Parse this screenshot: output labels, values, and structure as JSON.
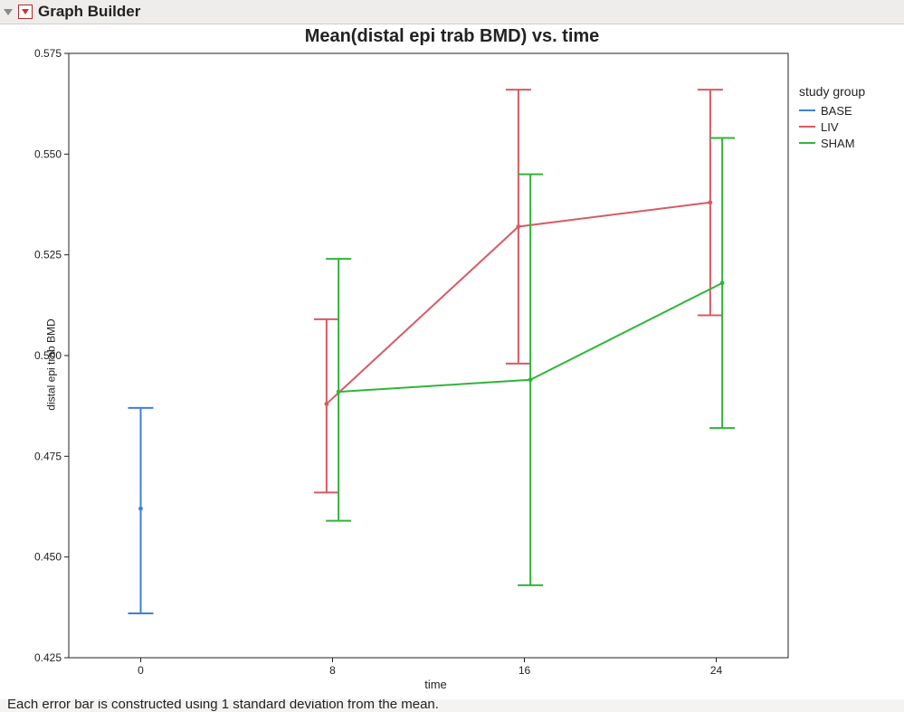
{
  "panel": {
    "title": "Graph Builder"
  },
  "chart_data": {
    "type": "line",
    "title": "Mean(distal epi trab BMD) vs. time",
    "xlabel": "time",
    "ylabel": "distal epi trab BMD",
    "xlim": [
      -3,
      27
    ],
    "ylim": [
      0.425,
      0.575
    ],
    "x_ticks": [
      0,
      8,
      16,
      24
    ],
    "y_ticks": [
      0.425,
      0.45,
      0.475,
      0.5,
      0.525,
      0.55,
      0.575
    ],
    "y_tick_labels": [
      "0.425",
      "0.450",
      "0.475",
      "0.500",
      "0.525",
      "0.550",
      "0.575"
    ],
    "legend_title": "study group",
    "series": [
      {
        "name": "BASE",
        "color": "#3f7fd6",
        "x": [
          0
        ],
        "mean": [
          0.462
        ],
        "low": [
          0.436
        ],
        "high": [
          0.487
        ],
        "x_offset": 0,
        "connect": false
      },
      {
        "name": "LIV",
        "color": "#d85a63",
        "x": [
          8,
          16,
          24
        ],
        "mean": [
          0.488,
          0.532,
          0.538
        ],
        "low": [
          0.466,
          0.498,
          0.51
        ],
        "high": [
          0.509,
          0.566,
          0.566
        ],
        "x_offset": -0.25,
        "connect": true
      },
      {
        "name": "SHAM",
        "color": "#2fb53a",
        "x": [
          8,
          16,
          24
        ],
        "mean": [
          0.491,
          0.494,
          0.518
        ],
        "low": [
          0.459,
          0.443,
          0.482
        ],
        "high": [
          0.524,
          0.545,
          0.554
        ],
        "x_offset": 0.25,
        "connect": true
      }
    ],
    "caption": "Each error bar is constructed using 1 standard deviation from the mean."
  }
}
